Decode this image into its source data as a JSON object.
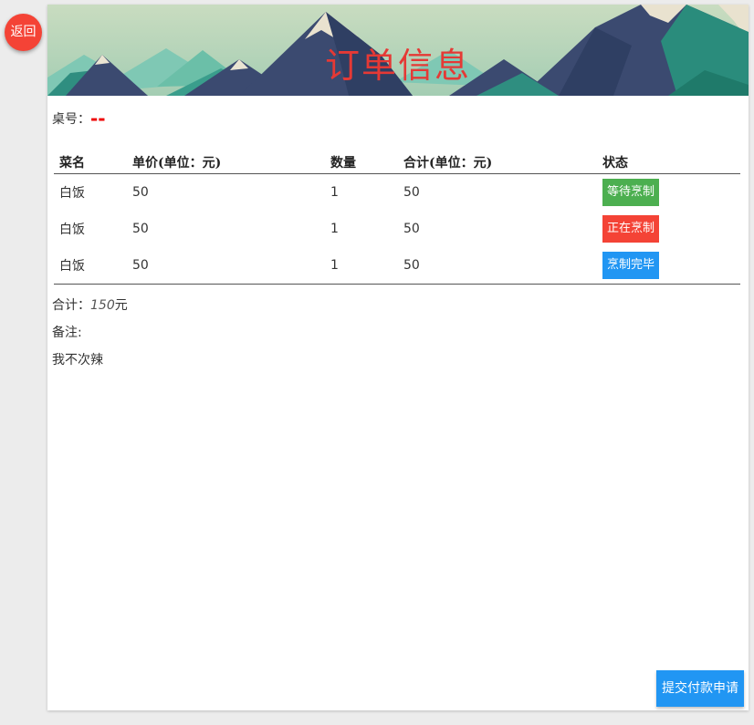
{
  "nav": {
    "back_label": "返回"
  },
  "banner": {
    "title": "订单信息"
  },
  "table_info": {
    "label": "桌号：",
    "value": "--"
  },
  "orders": {
    "headers": [
      "菜名",
      "单价(单位：元)",
      "数量",
      "合计(单位：元)",
      "状态"
    ],
    "rows": [
      {
        "name": "白饭",
        "price": "50",
        "qty": "1",
        "subtotal": "50",
        "status": "等待烹制",
        "status_color": "#4caf50"
      },
      {
        "name": "白饭",
        "price": "50",
        "qty": "1",
        "subtotal": "50",
        "status": "正在烹制",
        "status_color": "#f44336"
      },
      {
        "name": "白饭",
        "price": "50",
        "qty": "1",
        "subtotal": "50",
        "status": "烹制完毕",
        "status_color": "#2196f3"
      }
    ]
  },
  "summary": {
    "label": "合计：",
    "amount": "150",
    "unit": "元"
  },
  "remark": {
    "label": "备注:",
    "text": "我不次辣"
  },
  "actions": {
    "submit_label": "提交付款申请"
  },
  "colors": {
    "accent_red": "#e53935",
    "primary_blue": "#2196f3",
    "success_green": "#4caf50"
  }
}
